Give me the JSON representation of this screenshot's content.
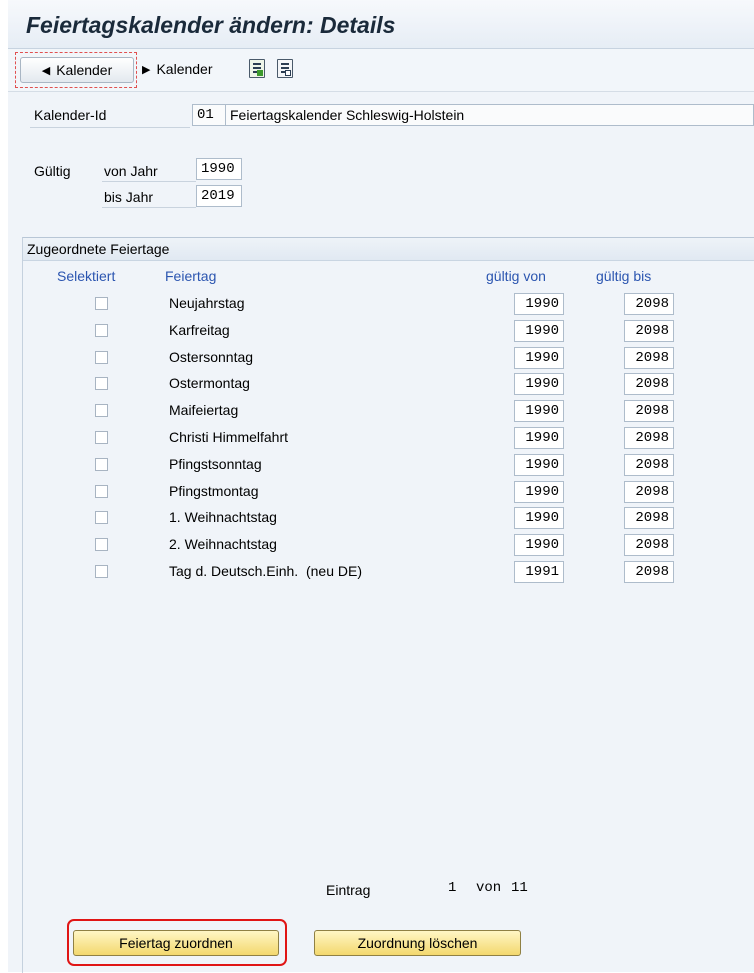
{
  "window": {
    "title": "Feiertagskalender ändern: Details"
  },
  "toolbar": {
    "back_label": "Kalender",
    "forward_label": "Kalender"
  },
  "calendar": {
    "id_label": "Kalender-Id",
    "id_value": "01",
    "name_value": "Feiertagskalender Schleswig-Holstein"
  },
  "validity": {
    "label": "Gültig",
    "from_label": "von Jahr",
    "from_value": "1990",
    "to_label": "bis Jahr",
    "to_value": "2019"
  },
  "holidays": {
    "group_title": "Zugeordnete Feiertage",
    "columns": {
      "selected": "Selektiert",
      "holiday": "Feiertag",
      "valid_from": "gültig von",
      "valid_to": "gültig bis"
    },
    "rows": [
      {
        "name": "Neujahrstag",
        "from": "1990",
        "to": "2098"
      },
      {
        "name": "Karfreitag",
        "from": "1990",
        "to": "2098"
      },
      {
        "name": "Ostersonntag",
        "from": "1990",
        "to": "2098"
      },
      {
        "name": "Ostermontag",
        "from": "1990",
        "to": "2098"
      },
      {
        "name": "Maifeiertag",
        "from": "1990",
        "to": "2098"
      },
      {
        "name": "Christi Himmelfahrt",
        "from": "1990",
        "to": "2098"
      },
      {
        "name": "Pfingstsonntag",
        "from": "1990",
        "to": "2098"
      },
      {
        "name": "Pfingstmontag",
        "from": "1990",
        "to": "2098"
      },
      {
        "name": "1. Weihnachtstag",
        "from": "1990",
        "to": "2098"
      },
      {
        "name": "2. Weihnachtstag",
        "from": "1990",
        "to": "2098"
      },
      {
        "name": "Tag d. Deutsch.Einh.  (neu DE)",
        "from": "1991",
        "to": "2098"
      }
    ]
  },
  "pager": {
    "label": "Eintrag",
    "current": "1",
    "of_label": "von",
    "total": "11"
  },
  "actions": {
    "assign_label": "Feiertag zuordnen",
    "delete_label": "Zuordnung löschen"
  },
  "colors": {
    "accent_blue": "#2b55b0",
    "highlight_red": "#e01515",
    "button_yellow": "#f3d86e"
  }
}
